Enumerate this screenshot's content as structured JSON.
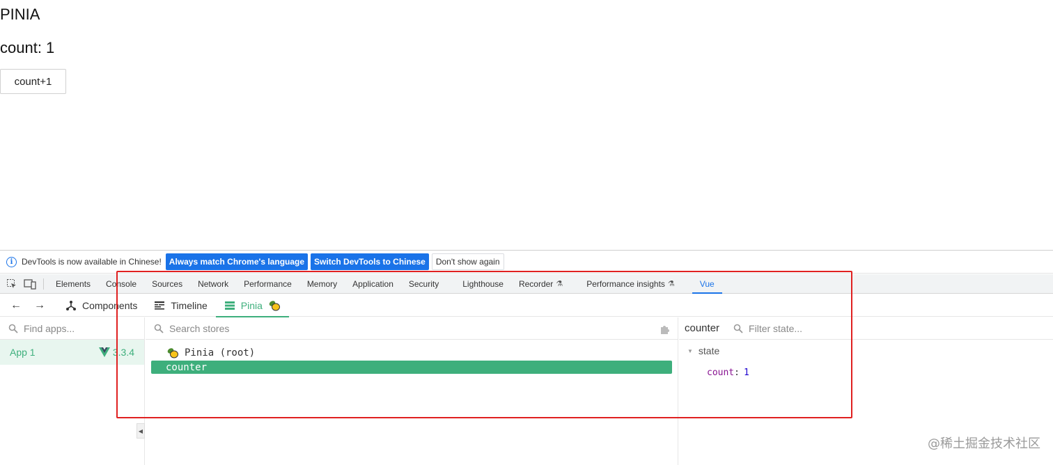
{
  "page": {
    "title": "PINIA",
    "count_label": "count: 1",
    "button_label": "count+1"
  },
  "infobar": {
    "message": "DevTools is now available in Chinese!",
    "btn_match": "Always match Chrome's language",
    "btn_switch": "Switch DevTools to Chinese",
    "btn_dismiss": "Don't show again"
  },
  "devtools_tabs": [
    "Elements",
    "Console",
    "Sources",
    "Network",
    "Performance",
    "Memory",
    "Application",
    "Security",
    "Lighthouse",
    "Recorder",
    "Performance insights",
    "Vue"
  ],
  "vue_tabs": {
    "components": "Components",
    "timeline": "Timeline",
    "pinia": "Pinia"
  },
  "apps": {
    "search_placeholder": "Find apps...",
    "app_name": "App 1",
    "app_version": "3.3.4"
  },
  "stores": {
    "search_placeholder": "Search stores",
    "root_label": "Pinia (root)",
    "selected_store": "counter"
  },
  "state": {
    "store_name": "counter",
    "filter_placeholder": "Filter state...",
    "section_label": "state",
    "key": "count",
    "value": "1"
  },
  "watermark": "@稀土掘金技术社区",
  "colors": {
    "vue_green": "#3eaf7c",
    "chrome_blue": "#1a73e8",
    "highlight_red": "#e02020"
  }
}
